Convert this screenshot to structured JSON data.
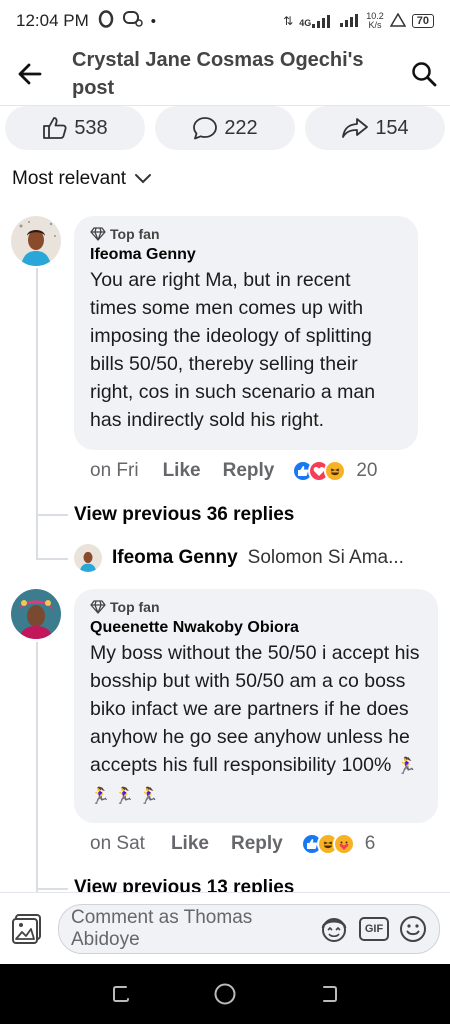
{
  "status_bar": {
    "time": "12:04 PM",
    "net_label": "4G",
    "speed_top": "10.2",
    "speed_bottom": "K/s",
    "battery": "70"
  },
  "header": {
    "title": "Crystal Jane Cosmas Ogechi's post"
  },
  "stats": {
    "likes": "538",
    "comments": "222",
    "shares": "154"
  },
  "sort": {
    "label": "Most relevant"
  },
  "comments": [
    {
      "badge": "Top fan",
      "author": "Ifeoma Genny",
      "text": "You are right Ma, but in recent times some men comes up with imposing the ideology of splitting bills 50/50, thereby selling their right, cos in such scenario a man has indirectly sold his right.",
      "time": "on Fri",
      "like_label": "Like",
      "reply_label": "Reply",
      "reaction_count": "20",
      "view_replies": "View previous 36 replies",
      "last_reply_author": "Ifeoma Genny",
      "last_reply_text": "Solomon Si Ama..."
    },
    {
      "badge": "Top fan",
      "author": "Queenette Nwakoby Obiora",
      "text": "My boss without the 50/50 i accept his bosship but with 50/50 am a co boss biko infact we are partners  if he does anyhow he go see anyhow unless he accepts his full responsibility 100%",
      "text_emoji": "🏃‍♀️ 🏃‍♀️ 🏃‍♀️ 🏃‍♀️",
      "time": "on Sat",
      "like_label": "Like",
      "reply_label": "Reply",
      "reaction_count": "6",
      "view_replies": "View previous 13 replies"
    }
  ],
  "composer": {
    "placeholder": "Comment as Thomas Abidoye",
    "gif_label": "GIF"
  },
  "colors": {
    "like_blue": "#1877f2",
    "love_red": "#f33e58",
    "haha_yellow": "#f7b125",
    "bubble_bg": "#f0f2f5"
  }
}
